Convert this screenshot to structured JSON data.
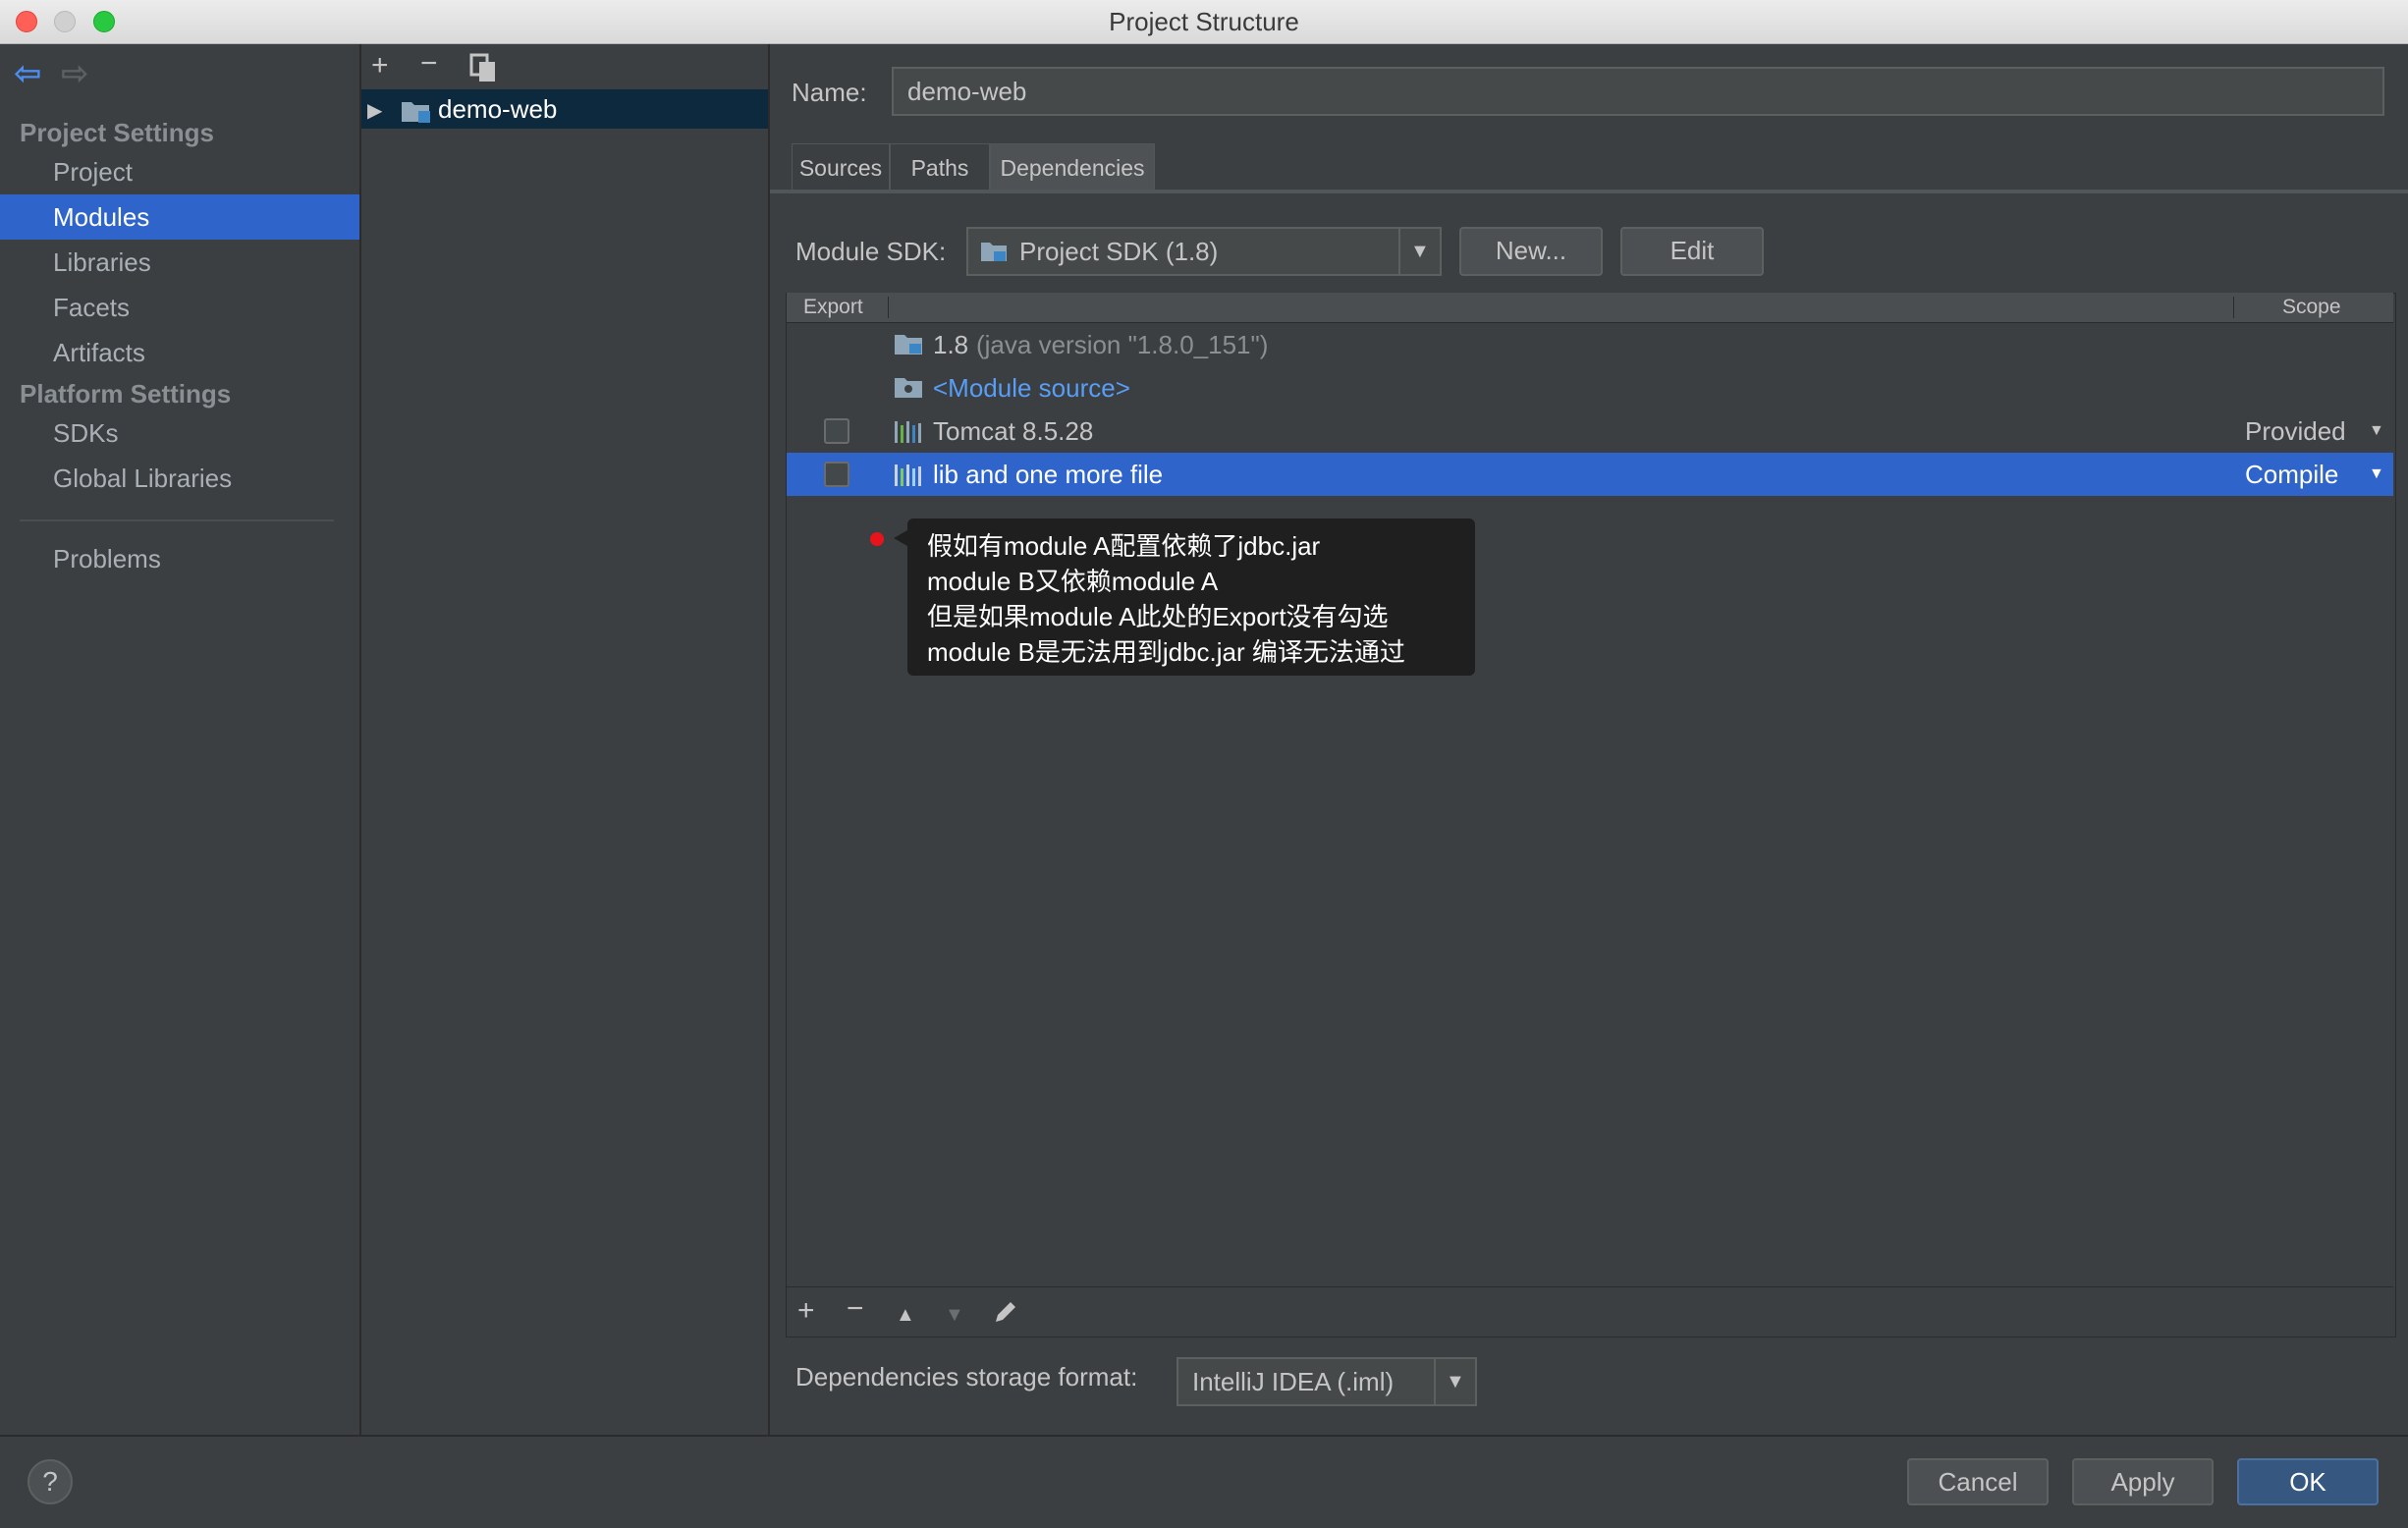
{
  "window": {
    "title": "Project Structure"
  },
  "sidebar": {
    "project_settings_header": "Project Settings",
    "platform_settings_header": "Platform Settings",
    "items": [
      {
        "label": "Project"
      },
      {
        "label": "Modules"
      },
      {
        "label": "Libraries"
      },
      {
        "label": "Facets"
      },
      {
        "label": "Artifacts"
      },
      {
        "label": "SDKs"
      },
      {
        "label": "Global Libraries"
      },
      {
        "label": "Problems"
      }
    ],
    "selected": "Modules"
  },
  "module_tree": {
    "items": [
      {
        "label": "demo-web",
        "expanded": false,
        "selected": true
      }
    ]
  },
  "details": {
    "name_label": "Name:",
    "name_value": "demo-web",
    "tabs": [
      {
        "label": "Sources",
        "active": false
      },
      {
        "label": "Paths",
        "active": false
      },
      {
        "label": "Dependencies",
        "active": true
      }
    ],
    "module_sdk_label": "Module SDK:",
    "module_sdk_value": "Project SDK (1.8)",
    "new_button": "New...",
    "edit_button": "Edit",
    "table": {
      "col_export": "Export",
      "col_scope": "Scope",
      "rows": [
        {
          "name": "1.8",
          "detail": "(java version \"1.8.0_151\")",
          "has_checkbox": false,
          "scope": ""
        },
        {
          "name": "<Module source>",
          "detail": "",
          "has_checkbox": false,
          "scope": ""
        },
        {
          "name": "Tomcat 8.5.28",
          "detail": "",
          "has_checkbox": true,
          "checked": false,
          "scope": "Provided"
        },
        {
          "name": "lib and one more file",
          "detail": "",
          "has_checkbox": true,
          "checked": false,
          "scope": "Compile",
          "selected": true
        }
      ]
    },
    "tooltip": {
      "lines": [
        "假如有module A配置依赖了jdbc.jar",
        "module B又依赖module A",
        "但是如果module A此处的Export没有勾选",
        "module B是无法用到jdbc.jar 编译无法通过"
      ]
    },
    "storage_format_label": "Dependencies storage format:",
    "storage_format_value": "IntelliJ IDEA (.iml)"
  },
  "footer": {
    "help": "?",
    "cancel": "Cancel",
    "apply": "Apply",
    "ok": "OK"
  },
  "colors": {
    "selection": "#2f65ca",
    "link": "#589df6",
    "background": "#3c3f41",
    "annotation_dot": "#e8141b"
  }
}
